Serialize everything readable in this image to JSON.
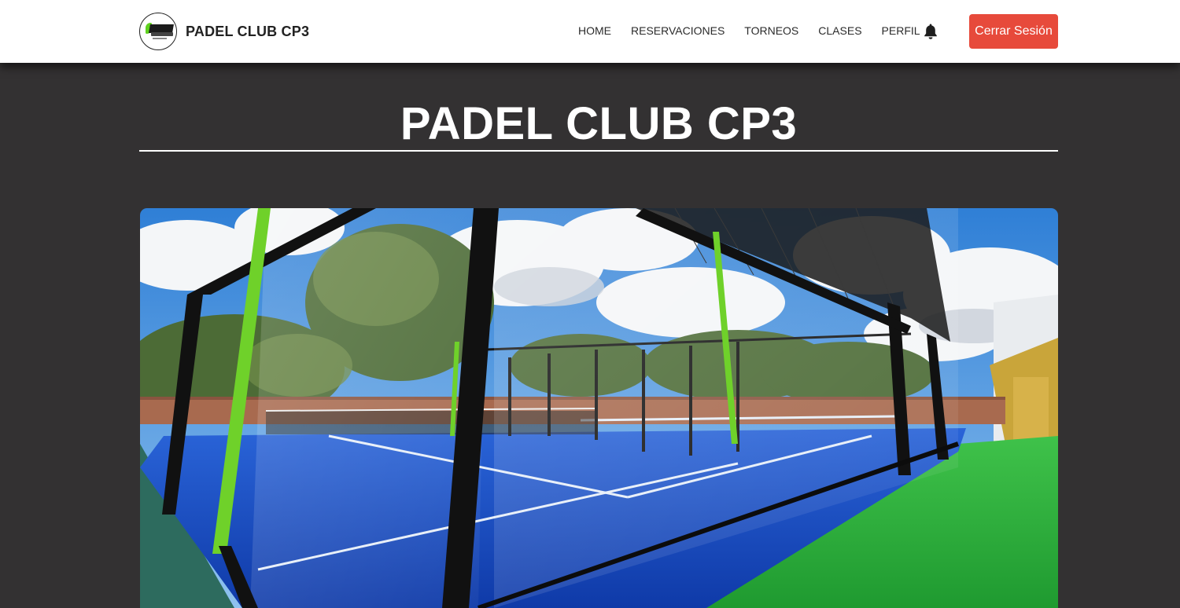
{
  "brand": {
    "name": "PADEL CLUB CP3",
    "logo_icon": "club-logo-icon"
  },
  "nav": {
    "links": [
      "HOME",
      "RESERVACIONES",
      "TORNEOS",
      "CLASES",
      "PERFIL"
    ],
    "notification_icon": "bell-icon",
    "logout_label": "Cerrar Sesión"
  },
  "hero": {
    "title": "PADEL CLUB CP3"
  },
  "colors": {
    "page_bg": "#333132",
    "navbar_bg": "#ffffff",
    "logout_bg": "#e74a3b",
    "court_blue": "#1f56c8",
    "turf_green": "#2fb33c"
  }
}
